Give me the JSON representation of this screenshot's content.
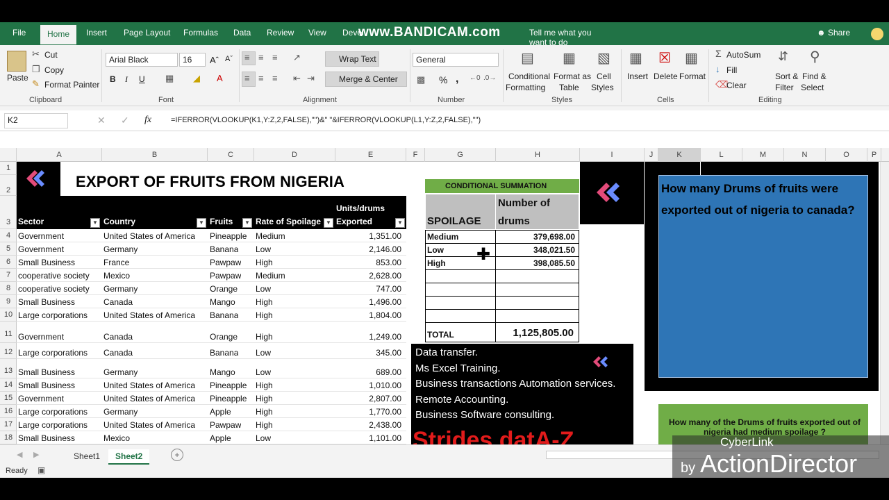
{
  "ribbon_tabs": [
    "File",
    "Home",
    "Insert",
    "Page Layout",
    "Formulas",
    "Data",
    "Review",
    "View",
    "Developer"
  ],
  "tell_me": "Tell me what you want to do",
  "share": "Share",
  "watermark_top": "www.BANDICAM.com",
  "clipboard": {
    "paste": "Paste",
    "cut": "Cut",
    "copy": "Copy",
    "format_painter": "Format Painter",
    "label": "Clipboard"
  },
  "font": {
    "name": "Arial Black",
    "size": "16",
    "label": "Font",
    "bold": "B",
    "italic": "I",
    "underline": "U"
  },
  "alignment": {
    "wrap": "Wrap Text",
    "merge": "Merge & Center",
    "label": "Alignment"
  },
  "number": {
    "format": "General",
    "label": "Number",
    "percent": "%",
    "comma": ","
  },
  "styles": {
    "conditional": "Conditional",
    "conditional2": "Formatting",
    "format_as": "Format as",
    "table": "Table",
    "cell": "Cell",
    "styles": "Styles",
    "label": "Styles"
  },
  "cells": {
    "insert": "Insert",
    "delete": "Delete",
    "format": "Format",
    "label": "Cells"
  },
  "editing": {
    "autosum": "AutoSum",
    "fill": "Fill",
    "clear": "Clear",
    "sort": "Sort &",
    "filter": "Filter",
    "find": "Find &",
    "select": "Select",
    "label": "Editing"
  },
  "name_box": "K2",
  "formula": "=IFERROR(VLOOKUP(K1,Y:Z,2,FALSE),\"\")&\"  \"&IFERROR(VLOOKUP(L1,Y:Z,2,FALSE),\"\")",
  "fx": "fx",
  "columns": [
    "A",
    "B",
    "C",
    "D",
    "E",
    "F",
    "G",
    "H",
    "I",
    "J",
    "K",
    "L",
    "M",
    "N",
    "O",
    "P"
  ],
  "rows": [
    "1",
    "2",
    "3",
    "4",
    "5",
    "6",
    "7",
    "8",
    "9",
    "10",
    "11",
    "12",
    "13",
    "14",
    "15",
    "16",
    "17",
    "18"
  ],
  "sheet_title": "EXPORT OF FRUITS FROM NIGERIA",
  "table_headers": {
    "sector": "Sector",
    "country": "Country",
    "fruits": "Fruits",
    "rate": "Rate of Spoilage",
    "units1": "Units/drums",
    "units2": "Exported"
  },
  "table_rows": [
    {
      "sector": "Government",
      "country": "United States of America",
      "fruit": "Pineapple",
      "rate": "Medium",
      "units": "1,351.00"
    },
    {
      "sector": "Government",
      "country": "Germany",
      "fruit": "Banana",
      "rate": "Low",
      "units": "2,146.00"
    },
    {
      "sector": "Small Business",
      "country": "France",
      "fruit": "Pawpaw",
      "rate": "High",
      "units": "853.00"
    },
    {
      "sector": "cooperative society",
      "country": "Mexico",
      "fruit": "Pawpaw",
      "rate": "Medium",
      "units": "2,628.00"
    },
    {
      "sector": "cooperative society",
      "country": "Germany",
      "fruit": "Orange",
      "rate": "Low",
      "units": "747.00"
    },
    {
      "sector": "Small Business",
      "country": "Canada",
      "fruit": "Mango",
      "rate": "High",
      "units": "1,496.00"
    },
    {
      "sector": "Large corporations",
      "country": "United States of America",
      "fruit": "Banana",
      "rate": "High",
      "units": "1,804.00"
    },
    {
      "sector": "Government",
      "country": "Canada",
      "fruit": "Orange",
      "rate": "High",
      "units": "1,249.00"
    },
    {
      "sector": "Large corporations",
      "country": "Canada",
      "fruit": "Banana",
      "rate": "Low",
      "units": "345.00"
    },
    {
      "sector": "Small Business",
      "country": "Germany",
      "fruit": "Mango",
      "rate": "Low",
      "units": "689.00"
    },
    {
      "sector": "Small Business",
      "country": "United States of America",
      "fruit": "Pineapple",
      "rate": "High",
      "units": "1,010.00"
    },
    {
      "sector": "Government",
      "country": "United States of America",
      "fruit": "Pineapple",
      "rate": "High",
      "units": "2,807.00"
    },
    {
      "sector": "Large corporations",
      "country": "Germany",
      "fruit": "Apple",
      "rate": "High",
      "units": "1,770.00"
    },
    {
      "sector": "Large corporations",
      "country": "United States of America",
      "fruit": "Pawpaw",
      "rate": "High",
      "units": "2,438.00"
    },
    {
      "sector": "Small Business",
      "country": "Mexico",
      "fruit": "Apple",
      "rate": "Low",
      "units": "1,101.00"
    }
  ],
  "cond_sum": {
    "title": "CONDITIONAL SUMMATION",
    "col1": "SPOILAGE",
    "col2a": "Number of",
    "col2b": "drums",
    "rows": [
      {
        "label": "Medium",
        "value": "379,698.00"
      },
      {
        "label": "Low",
        "value": "348,021.50"
      },
      {
        "label": "High",
        "value": "398,085.50"
      }
    ],
    "total_label": "TOTAL",
    "total_value": "1,125,805.00"
  },
  "ad": {
    "lines": [
      "Data transfer.",
      "Ms Excel Training.",
      "Business transactions Automation services.",
      "Remote Accounting.",
      "Business Software consulting."
    ],
    "brand": "Strides datA-Z"
  },
  "question1": "How many Drums of fruits were exported out of nigeria to canada?",
  "question2": "How many of the Drums of fruits exported out of nigeria had medium spoilage ?",
  "sheets": [
    "Sheet1",
    "Sheet2"
  ],
  "status": "Ready",
  "watermark_bottom": {
    "line1": "CyberLink",
    "line2": "ActionDirector",
    "by": "by"
  },
  "colors": {
    "excel_green": "#217346",
    "sum_green": "#70ad47",
    "question_blue": "#2e75b6"
  }
}
